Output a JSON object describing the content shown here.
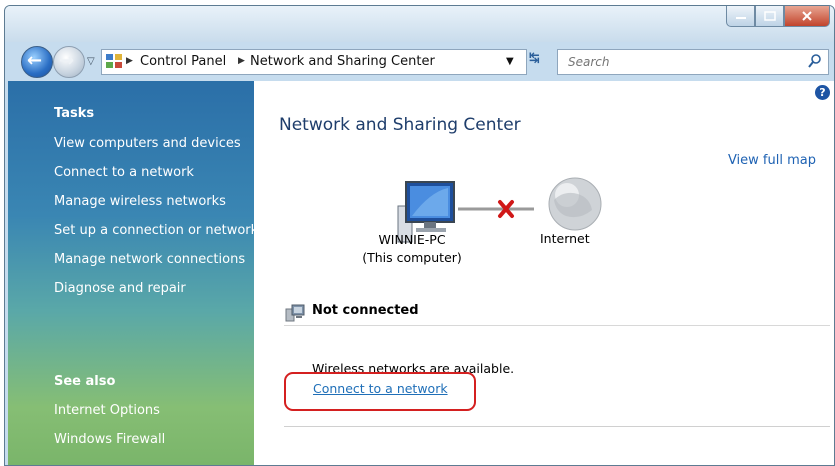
{
  "window": {
    "controls": {
      "minimize_icon": "minimize-icon",
      "maximize_icon": "maximize-icon",
      "close_icon": "close-icon"
    }
  },
  "address_bar": {
    "breadcrumbs": [
      "Control Panel",
      "Network and Sharing Center"
    ],
    "search_placeholder": "Search"
  },
  "sidebar": {
    "tasks_heading": "Tasks",
    "tasks": [
      "View computers and devices",
      "Connect to a network",
      "Manage wireless networks",
      "Set up a connection or network",
      "Manage network connections",
      "Diagnose and repair"
    ],
    "see_also_heading": "See also",
    "see_also": [
      "Internet Options",
      "Windows Firewall"
    ]
  },
  "main": {
    "title": "Network and Sharing Center",
    "view_full_map": "View full map",
    "computer_name": "WINNIE-PC",
    "computer_sub": "(This computer)",
    "internet_label": "Internet",
    "status": "Not connected",
    "wireless_message": "Wireless networks are available.",
    "connect_link": "Connect to a network"
  },
  "colors": {
    "link": "#1f6fb8",
    "title": "#1e3d6b",
    "highlight_box": "#d42020",
    "disconnect_x": "#d01818"
  }
}
